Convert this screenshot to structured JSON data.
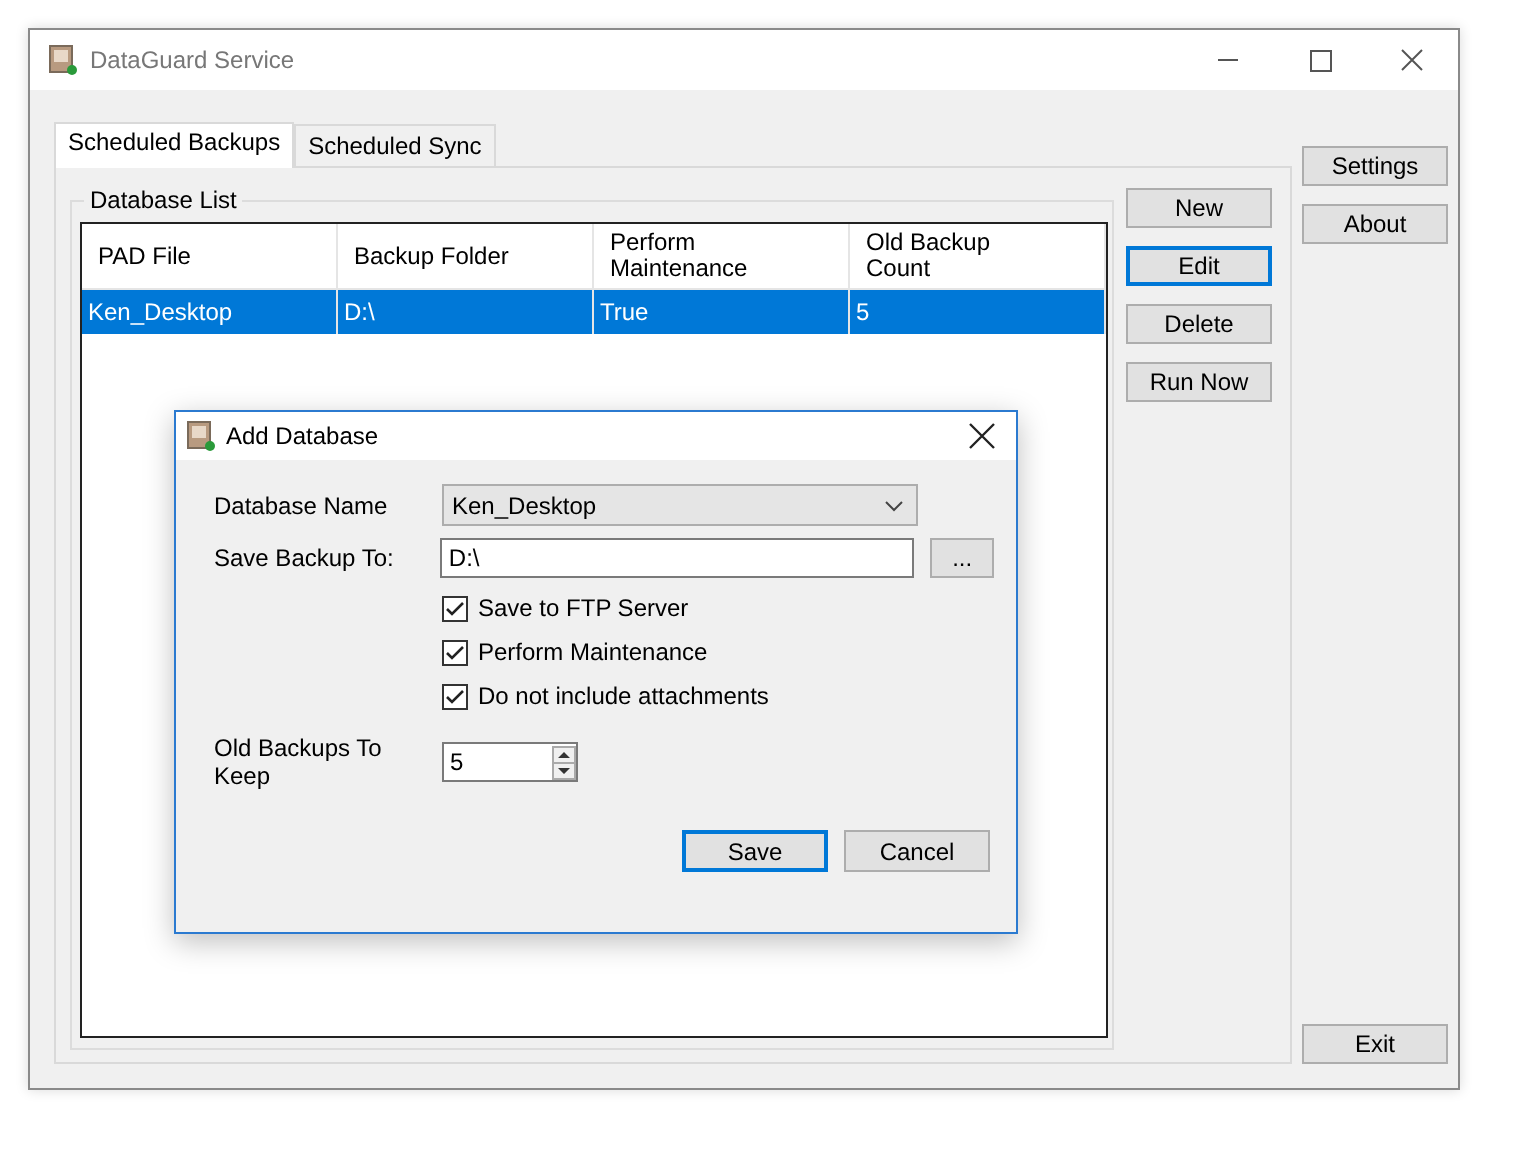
{
  "window": {
    "title": "DataGuard Service"
  },
  "tabs": [
    {
      "label": "Scheduled Backups",
      "selected": true
    },
    {
      "label": "Scheduled Sync",
      "selected": false
    }
  ],
  "group": {
    "title": "Database List"
  },
  "table": {
    "columns": [
      "PAD File",
      "Backup Folder",
      "Perform Maintenance",
      "Old Backup Count"
    ],
    "rows": [
      {
        "cells": [
          "Ken_Desktop",
          "D:\\",
          "True",
          "5"
        ],
        "selected": true
      }
    ]
  },
  "list_buttons": [
    {
      "label": "New",
      "focused": false
    },
    {
      "label": "Edit",
      "focused": true
    },
    {
      "label": "Delete",
      "focused": false
    },
    {
      "label": "Run Now",
      "focused": false
    }
  ],
  "side_buttons": [
    {
      "label": "Settings",
      "focused": false
    },
    {
      "label": "About",
      "focused": false
    }
  ],
  "exit_button": {
    "label": "Exit",
    "focused": false
  },
  "dialog": {
    "title": "Add Database",
    "database_name": {
      "label": "Database Name",
      "value": "Ken_Desktop"
    },
    "save_to": {
      "label": "Save Backup To:",
      "value": "D:\\",
      "browse": "..."
    },
    "checkboxes": [
      {
        "label": "Save to FTP Server",
        "checked": true
      },
      {
        "label": "Perform Maintenance",
        "checked": true
      },
      {
        "label": "Do not include attachments",
        "checked": true
      }
    ],
    "keep": {
      "label": "Old Backups To Keep",
      "value": "5"
    },
    "buttons": [
      {
        "label": "Save",
        "focused": true
      },
      {
        "label": "Cancel",
        "focused": false
      }
    ]
  }
}
